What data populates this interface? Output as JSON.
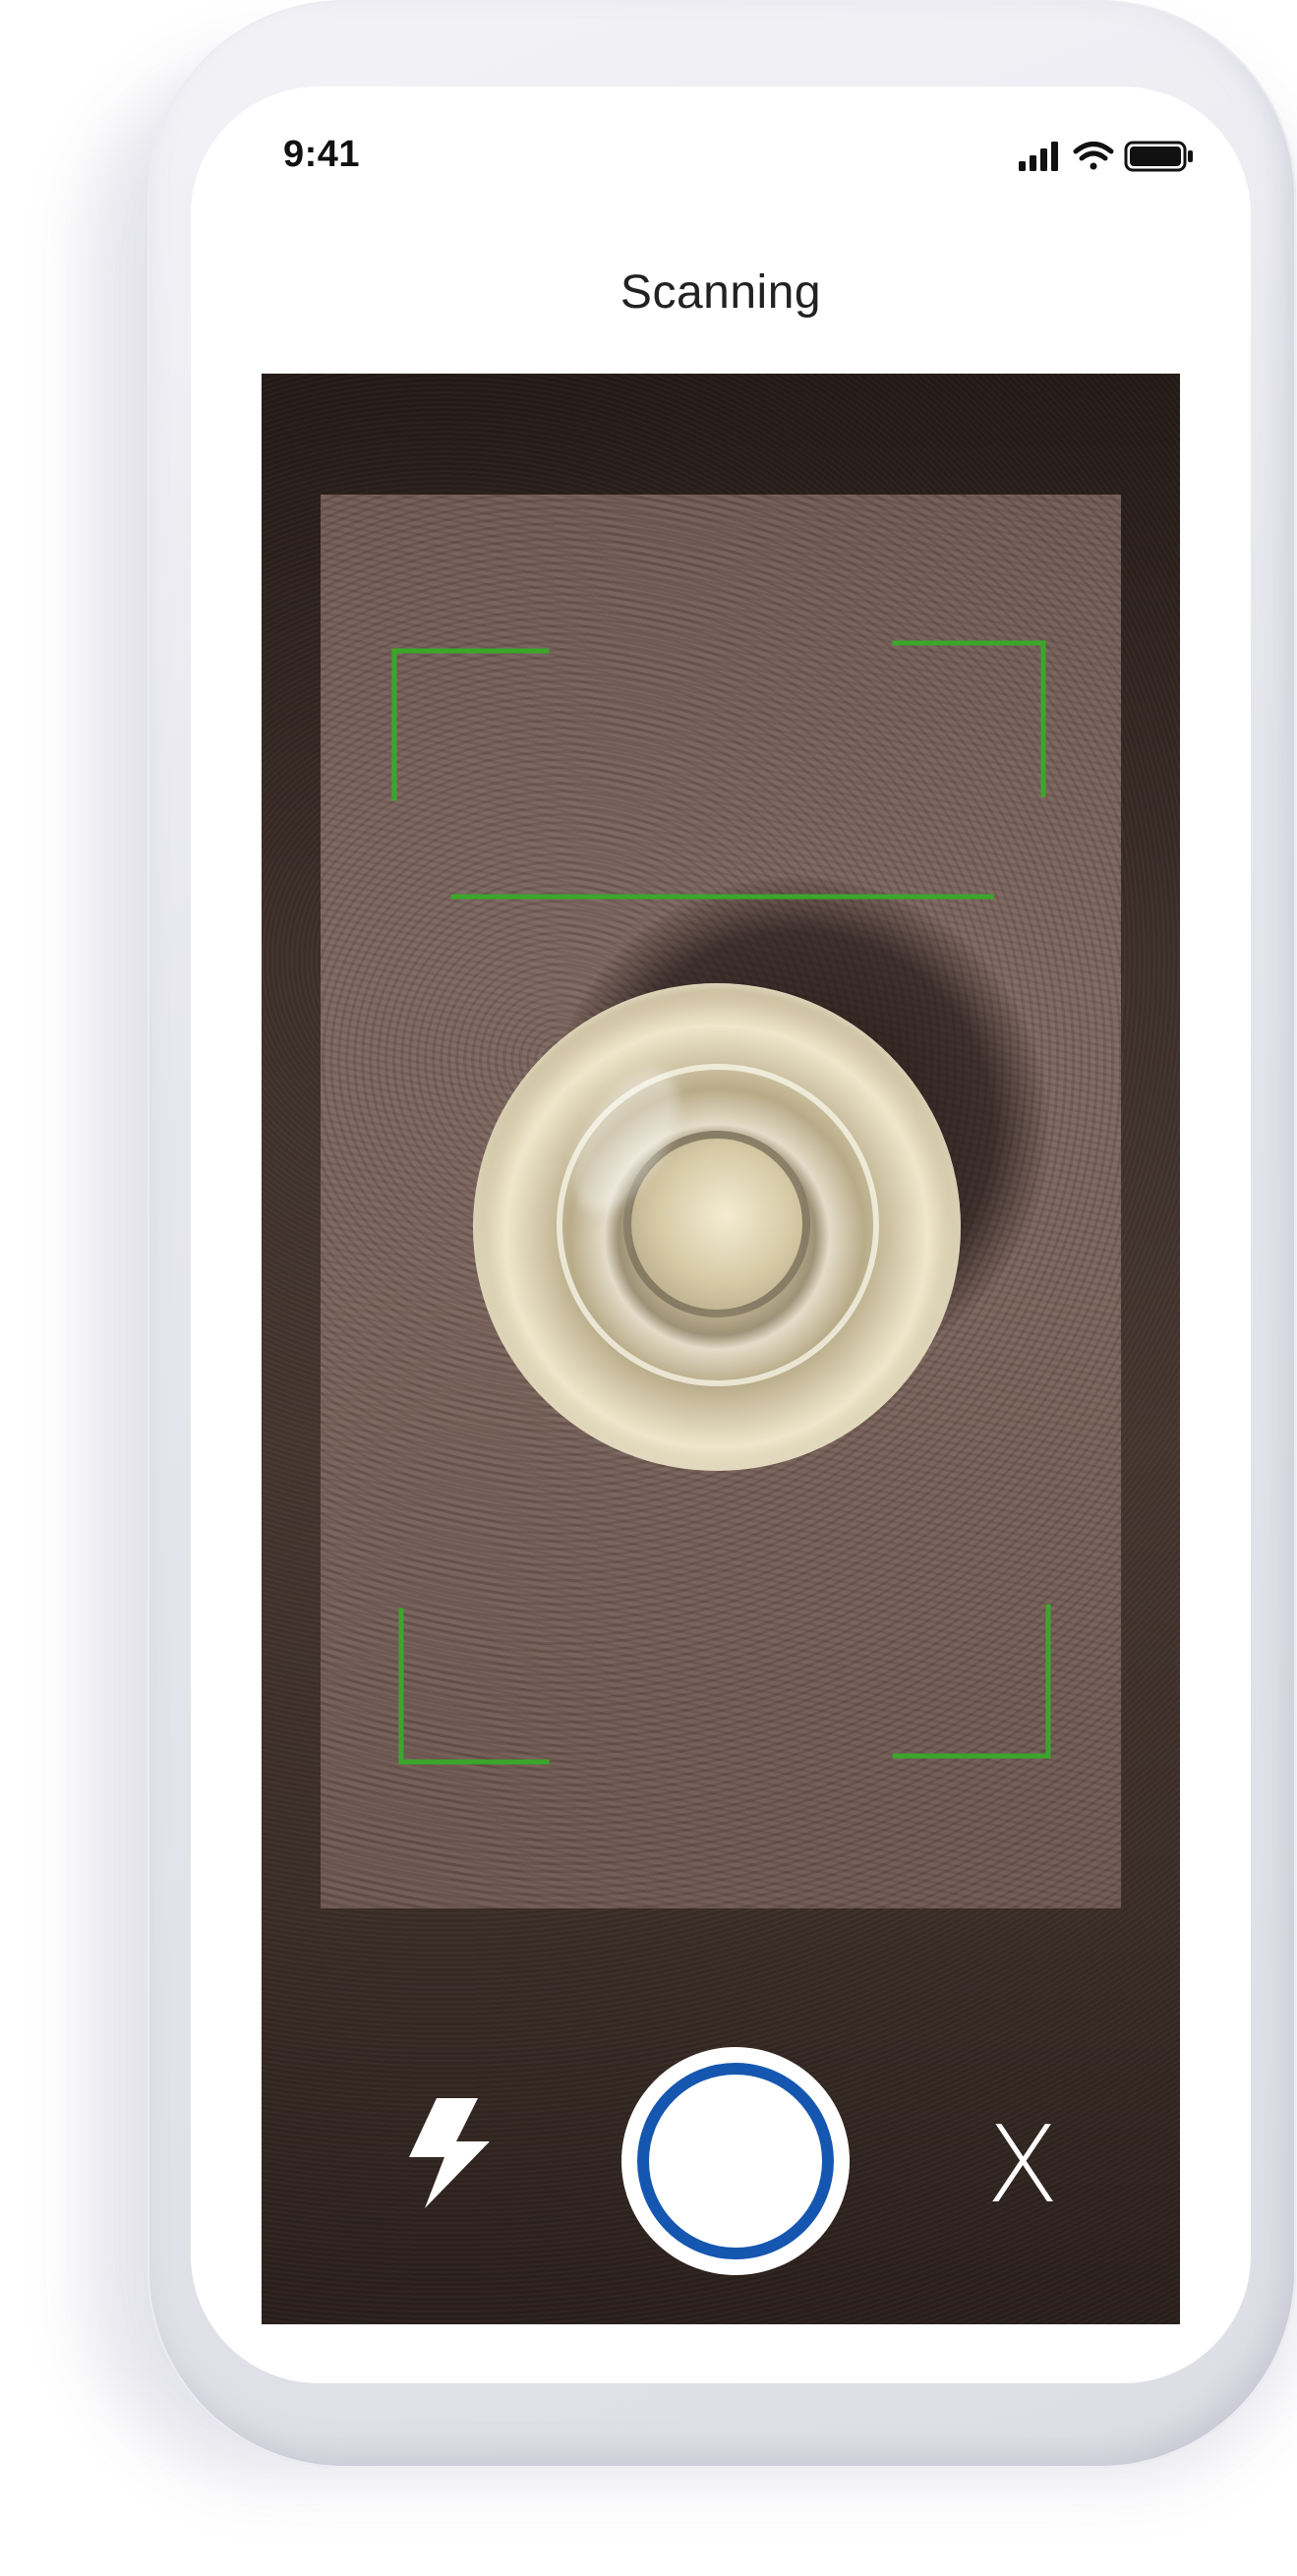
{
  "status_bar": {
    "time": "9:41",
    "signal_icon": "cellular-signal-icon",
    "wifi_icon": "wifi-icon",
    "battery_icon": "battery-icon"
  },
  "header": {
    "title": "Scanning"
  },
  "camera": {
    "scan_frame_color": "#3aa72a",
    "subject": "glass-object"
  },
  "controls": {
    "flash_icon": "flash-icon",
    "shutter_icon": "shutter-icon",
    "shutter_color": "#1557b0",
    "close_label": "X"
  }
}
